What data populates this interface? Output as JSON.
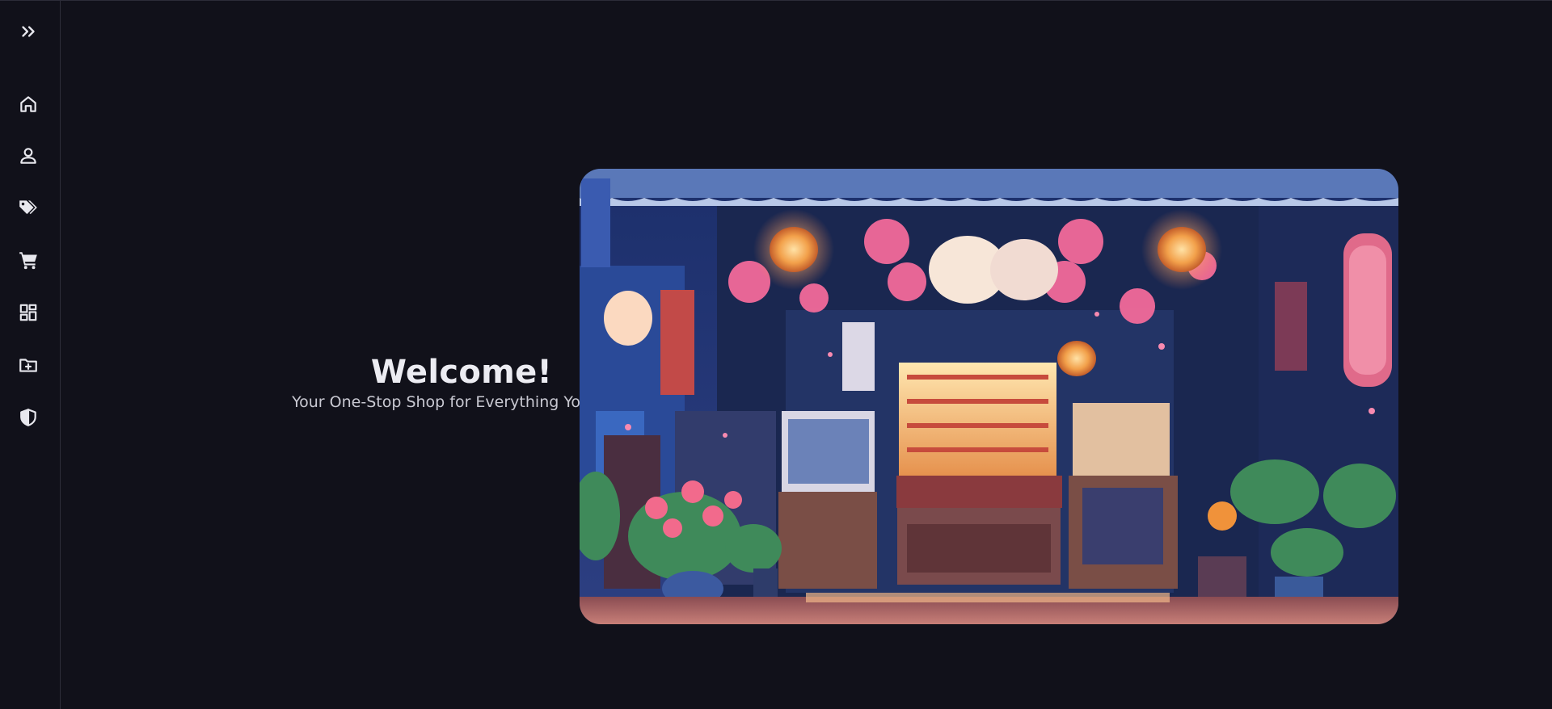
{
  "sidebar": {
    "items": [
      {
        "name": "expand",
        "icon": "chevrons-right-icon"
      },
      {
        "name": "home",
        "icon": "home-icon"
      },
      {
        "name": "profile",
        "icon": "user-icon"
      },
      {
        "name": "deals",
        "icon": "tags-icon"
      },
      {
        "name": "cart",
        "icon": "cart-icon"
      },
      {
        "name": "dashboard",
        "icon": "dashboard-icon"
      },
      {
        "name": "add-folder",
        "icon": "folder-plus-icon"
      },
      {
        "name": "security",
        "icon": "shield-icon"
      }
    ]
  },
  "hero": {
    "title": "Welcome!",
    "subtitle": "Your One-Stop Shop for Everything You Love"
  },
  "colors": {
    "background": "#11111a",
    "text": "#ececf2",
    "subtext": "#c9c9d2",
    "border": "#2e2e3a"
  }
}
